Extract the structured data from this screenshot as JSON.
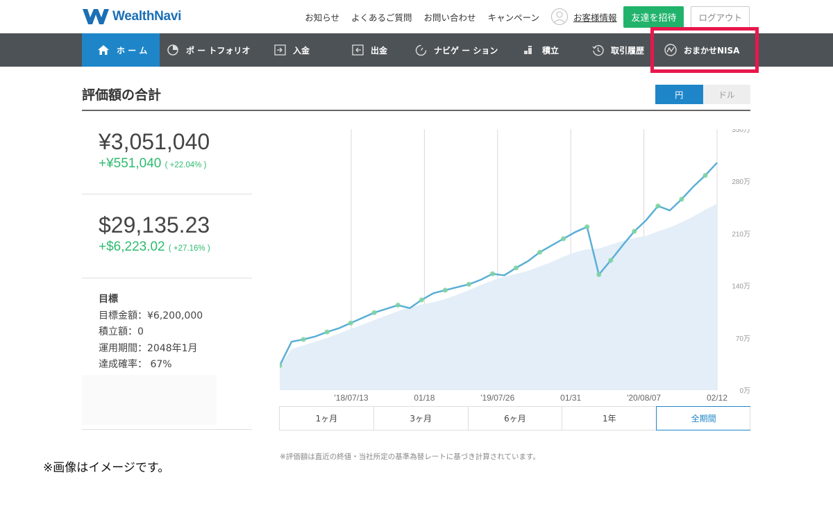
{
  "header": {
    "logo_text": "WealthNavi",
    "links": [
      "お知らせ",
      "よくあるご質問",
      "お問い合わせ",
      "キャンペーン"
    ],
    "account_label": "お客様情報",
    "invite_label": "友達を招待",
    "logout_label": "ログアウト"
  },
  "nav": {
    "items": [
      {
        "label": "ホ ー ム",
        "icon": "home-icon"
      },
      {
        "label": "ポ ー トフォリオ",
        "icon": "pie-chart-icon"
      },
      {
        "label": "入金",
        "icon": "deposit-icon"
      },
      {
        "label": "出金",
        "icon": "withdraw-icon"
      },
      {
        "label": "ナビゲ ー ション",
        "icon": "navigation-icon"
      },
      {
        "label": "積立",
        "icon": "bars-icon"
      },
      {
        "label": "取引履歴",
        "icon": "history-icon"
      },
      {
        "label": "おまかせNISA",
        "icon": "nisa-icon"
      }
    ],
    "active_color": "#1e86c8",
    "highlight_color": "#e8174c"
  },
  "section": {
    "title": "評価額の合計",
    "currency_yen": "円",
    "currency_usd": "ドル"
  },
  "summary": {
    "yen_total": "¥3,051,040",
    "yen_gain": "+¥551,040",
    "yen_pct": "( +22.04% )",
    "usd_total": "$29,135.23",
    "usd_gain": "+$6,223.02",
    "usd_pct": "( +27.16% )",
    "gain_color": "#2dbb6f"
  },
  "goal": {
    "title": "目標",
    "target": "目標金額：¥6,200,000",
    "monthly": "積立額：0",
    "period": "運用期間：2048年1月",
    "probability": "達成確率： 67%"
  },
  "chart_data": {
    "type": "area",
    "x_ticks": [
      "'18/07/13",
      "01/18",
      "'19/07/26",
      "01/31",
      "'20/08/07",
      "02/12"
    ],
    "y_ticks": [
      "0万",
      "70万",
      "140万",
      "210万",
      "280万",
      "350万"
    ],
    "ylim": [
      0,
      3500000
    ],
    "series": [
      {
        "color": "#5aafd6",
        "values": [
          330000,
          650000,
          680000,
          720000,
          780000,
          830000,
          900000,
          970000,
          1040000,
          1090000,
          1140000,
          1100000,
          1210000,
          1300000,
          1340000,
          1380000,
          1420000,
          1480000,
          1560000,
          1540000,
          1640000,
          1730000,
          1850000,
          1940000,
          2030000,
          2120000,
          2190000,
          1550000,
          1740000,
          1940000,
          2130000,
          2280000,
          2470000,
          2410000,
          2560000,
          2730000,
          2880000,
          3050000
        ]
      },
      {
        "values": [
          330000,
          550000,
          600000,
          650000,
          700000,
          760000,
          820000,
          880000,
          940000,
          1000000,
          1060000,
          1110000,
          1150000,
          1180000,
          1220000,
          1280000,
          1340000,
          1410000,
          1470000,
          1520000,
          1560000,
          1600000,
          1660000,
          1720000,
          1790000,
          1850000,
          1890000,
          1900000,
          1950000,
          2000000,
          2040000,
          2070000,
          2130000,
          2180000,
          2250000,
          2330000,
          2420000,
          2500000
        ]
      }
    ],
    "fill_color": "#e4eef8",
    "grid": true
  },
  "ranges": [
    "1ヶ月",
    "3ヶ月",
    "6ヶ月",
    "1年",
    "全期間"
  ],
  "note": "※評価額は直近の終値・当社所定の基準為替レートに基づき計算されています。",
  "caption": "※画像はイメージです。"
}
